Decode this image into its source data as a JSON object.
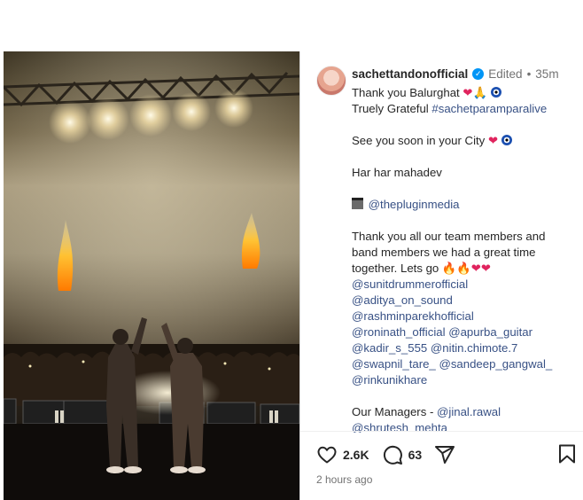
{
  "post": {
    "username": "sachettandonofficial",
    "edited": "Edited",
    "separator": "•",
    "time_ago": "35m",
    "caption_lines": [
      "Thank you Balurghat",
      "Truely Grateful",
      "#sachetparamparalive",
      "See you soon in your City",
      "Har har mahadev",
      "@thepluginmedia",
      "Thank you all our team members and",
      "band members we had a great time",
      "together. Lets go",
      "@sunitdrummerofficial",
      "@aditya_on_sound",
      "@rashminparekhofficial",
      "@roninath_official",
      "@apurba_guitar",
      "@kadir_s_555",
      "@nitin.chimote.7",
      "@swapnil_tare_",
      "@sandeep_gangwal_",
      "@rinkunikhare",
      "Our Managers - ",
      "@jinal.rawal",
      "@shrutesh_mehta"
    ],
    "likes": "2.6K",
    "comments": "63",
    "posted": "2 hours ago"
  },
  "icons": {
    "verified": "verified-badge-icon",
    "like": "heart-outline-icon",
    "comment": "comment-bubble-icon",
    "share": "paper-plane-icon",
    "save": "bookmark-icon"
  },
  "colors": {
    "link": "#385185",
    "verified": "#0095f6",
    "muted": "#737373"
  }
}
